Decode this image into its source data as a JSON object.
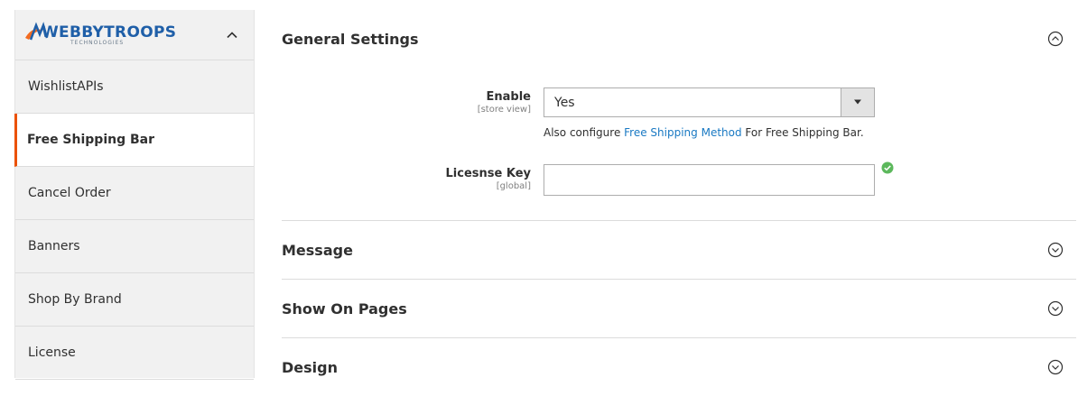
{
  "brand": {
    "logo_text": "WEBBYTROOPS",
    "logo_subtext": "TECHNOLOGIES",
    "colors": {
      "accent": "#eb5202",
      "link": "#1979c3",
      "logo_blue": "#1f5fa8",
      "logo_orange": "#f26b21",
      "success": "#5cb85c"
    }
  },
  "sidebar": {
    "items": [
      {
        "label": "WishlistAPIs"
      },
      {
        "label": "Free Shipping Bar",
        "active": true
      },
      {
        "label": "Cancel Order"
      },
      {
        "label": "Banners"
      },
      {
        "label": "Shop By Brand"
      },
      {
        "label": "License"
      }
    ]
  },
  "sections": {
    "general": {
      "title": "General Settings",
      "state": "expanded"
    },
    "message": {
      "title": "Message",
      "state": "collapsed"
    },
    "show_on_pages": {
      "title": "Show On Pages",
      "state": "collapsed"
    },
    "design": {
      "title": "Design",
      "state": "collapsed"
    }
  },
  "fields": {
    "enable": {
      "label": "Enable",
      "scope": "[store view]",
      "value": "Yes",
      "note_prefix": "Also configure ",
      "note_link": "Free Shipping Method",
      "note_suffix": " For Free Shipping Bar."
    },
    "license_key": {
      "label": "Licesnse Key",
      "scope": "[global]",
      "value": ""
    }
  }
}
